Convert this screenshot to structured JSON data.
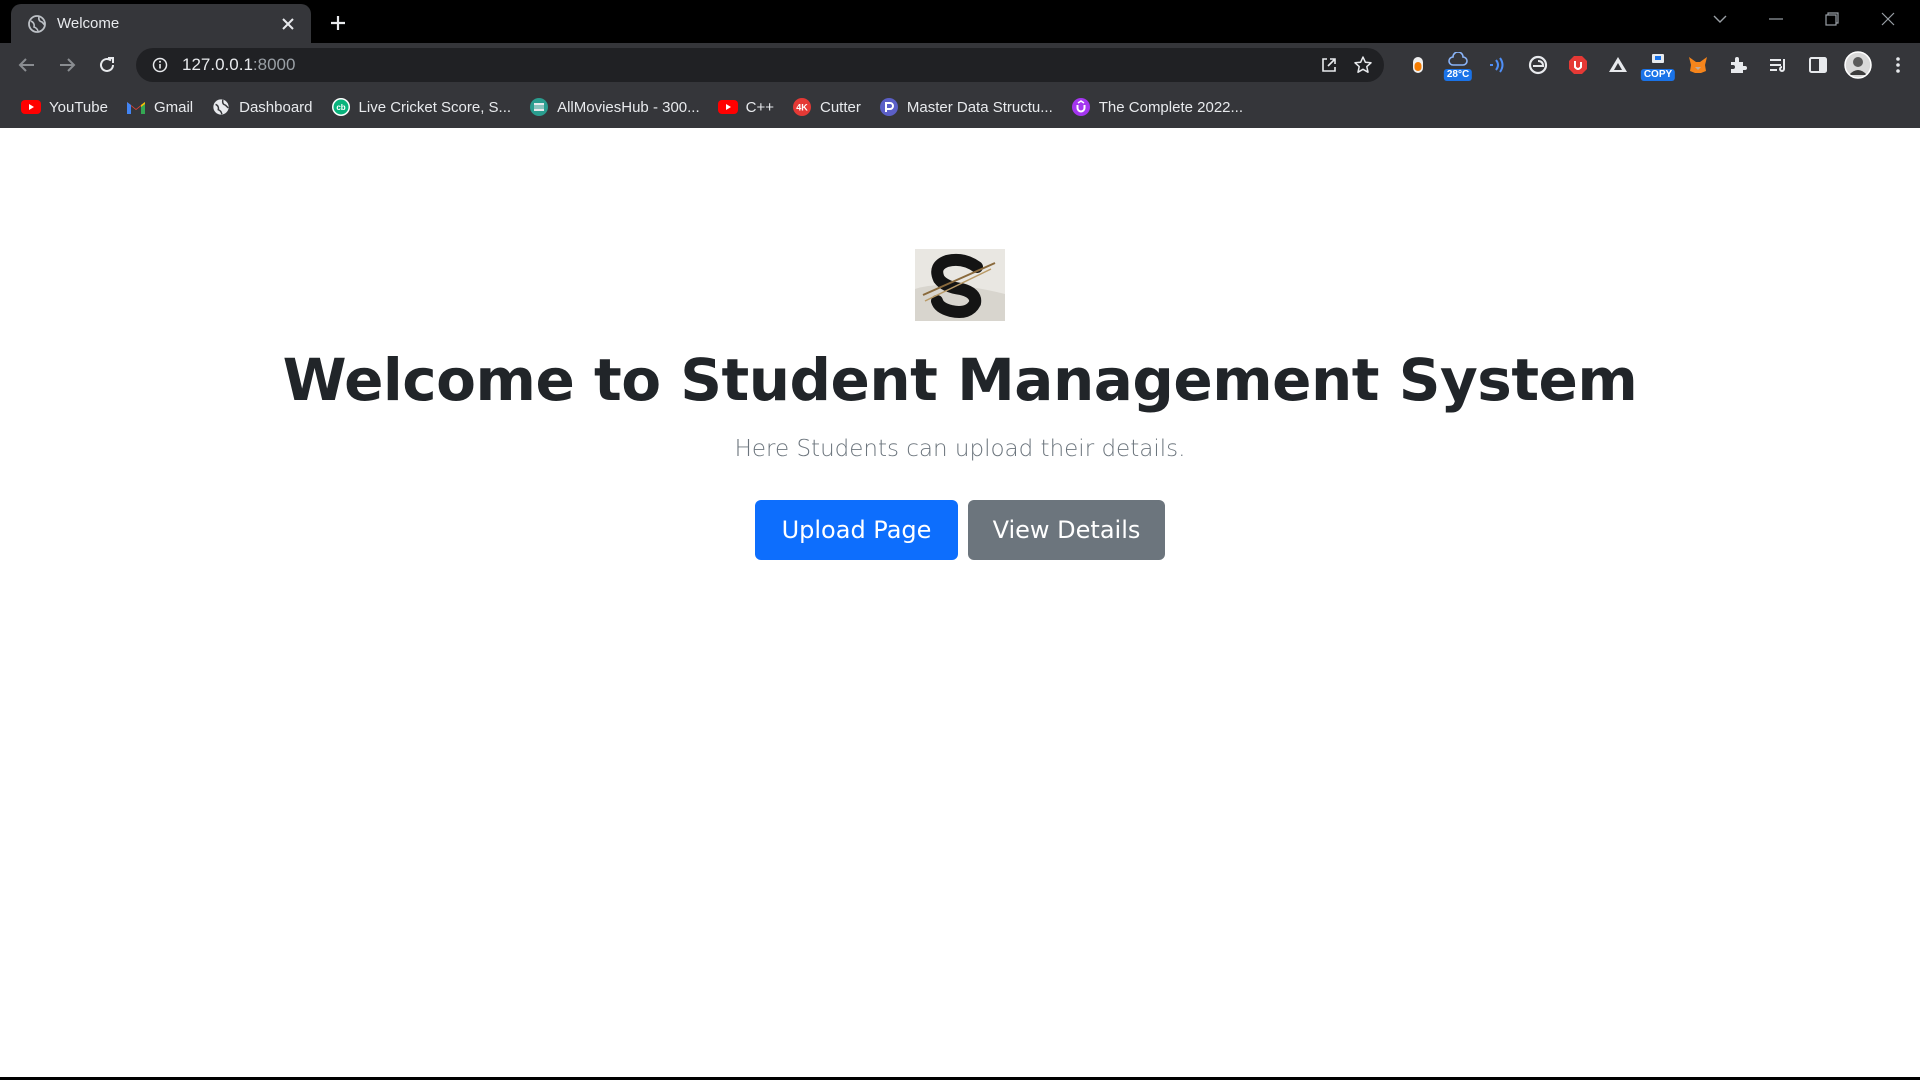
{
  "browser": {
    "tab": {
      "title": "Welcome"
    },
    "address": {
      "host": "127.0.0.1",
      "port": ":8000"
    },
    "extensions": [
      {
        "name": "stop-sign-extension-icon"
      },
      {
        "name": "weather-extension-icon",
        "badge": "28°C",
        "badge_color": "#1a73e8"
      },
      {
        "name": "read-aloud-extension-icon"
      },
      {
        "name": "edge-extension-icon"
      },
      {
        "name": "adblock-extension-icon"
      },
      {
        "name": "drive-extension-icon"
      },
      {
        "name": "copy-extension-icon",
        "badge": "COPY",
        "badge_color": "#1a73e8"
      },
      {
        "name": "metamask-extension-icon"
      },
      {
        "name": "puzzle-extensions-icon"
      },
      {
        "name": "reading-list-icon"
      },
      {
        "name": "side-panel-icon"
      },
      {
        "name": "profile-avatar"
      },
      {
        "name": "menu-kebab-icon"
      }
    ],
    "bookmarks": [
      {
        "label": "YouTube",
        "icon": "youtube-icon",
        "color": "#ff0000"
      },
      {
        "label": "Gmail",
        "icon": "gmail-icon",
        "color": "#ea4335"
      },
      {
        "label": "Dashboard",
        "icon": "globe-icon",
        "color": "#e8eaed"
      },
      {
        "label": "Live Cricket Score, S...",
        "icon": "cricbuzz-icon",
        "color": "#09b37c"
      },
      {
        "label": "AllMoviesHub - 300...",
        "icon": "allmovieshub-icon",
        "color": "#2a9d8f"
      },
      {
        "label": "C++",
        "icon": "youtube-icon",
        "color": "#ff0000"
      },
      {
        "label": "Cutter",
        "icon": "4k-icon",
        "color": "#e53935"
      },
      {
        "label": "Master Data Structu...",
        "icon": "course-icon",
        "color": "#5b5fc7"
      },
      {
        "label": "The Complete 2022...",
        "icon": "udemy-icon",
        "color": "#a435f0"
      }
    ]
  },
  "page": {
    "title": "Welcome to Student Management System",
    "subtitle": "Here Students can upload their details.",
    "buttons": {
      "upload": "Upload Page",
      "view": "View Details"
    },
    "colors": {
      "primary": "#0d6efd",
      "secondary": "#6c757d",
      "heading": "#212529"
    }
  }
}
